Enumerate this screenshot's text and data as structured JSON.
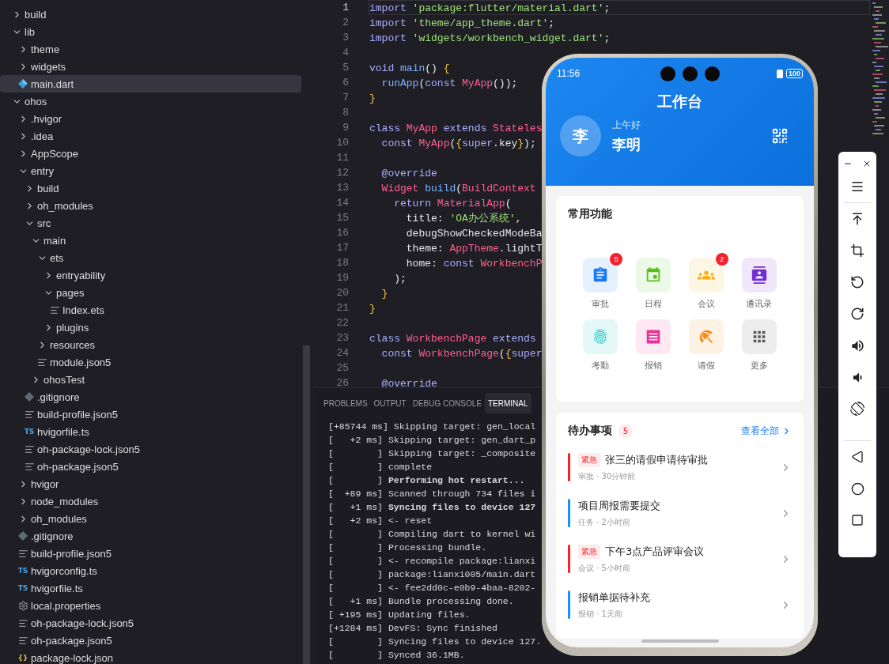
{
  "explorer": {
    "tree": [
      {
        "name": "build",
        "kind": "folder",
        "expanded": false,
        "selected": false
      },
      {
        "name": "lib",
        "kind": "folder",
        "expanded": true,
        "selected": false,
        "children": [
          {
            "name": "theme",
            "kind": "folder",
            "expanded": false,
            "selected": false
          },
          {
            "name": "widgets",
            "kind": "folder",
            "expanded": false,
            "selected": false
          },
          {
            "name": "main.dart",
            "kind": "dart",
            "selected": true
          }
        ]
      },
      {
        "name": "ohos",
        "kind": "folder",
        "expanded": true,
        "selected": false,
        "children": [
          {
            "name": ".hvigor",
            "kind": "folder",
            "expanded": false,
            "selected": false
          },
          {
            "name": ".idea",
            "kind": "folder",
            "expanded": false,
            "selected": false
          },
          {
            "name": "AppScope",
            "kind": "folder",
            "expanded": false,
            "selected": false
          },
          {
            "name": "entry",
            "kind": "folder",
            "expanded": true,
            "selected": false,
            "children": [
              {
                "name": "build",
                "kind": "folder",
                "expanded": false,
                "selected": false
              },
              {
                "name": "oh_modules",
                "kind": "folder",
                "expanded": false,
                "selected": false
              },
              {
                "name": "src",
                "kind": "folder",
                "expanded": true,
                "selected": false,
                "children": [
                  {
                    "name": "main",
                    "kind": "folder",
                    "expanded": true,
                    "selected": false,
                    "children": [
                      {
                        "name": "ets",
                        "kind": "folder",
                        "expanded": true,
                        "selected": false,
                        "children": [
                          {
                            "name": "entryability",
                            "kind": "folder",
                            "expanded": false,
                            "selected": false
                          },
                          {
                            "name": "pages",
                            "kind": "folder",
                            "expanded": true,
                            "selected": false,
                            "children": [
                              {
                                "name": "Index.ets",
                                "kind": "text",
                                "selected": false
                              }
                            ]
                          },
                          {
                            "name": "plugins",
                            "kind": "folder",
                            "expanded": false,
                            "selected": false
                          }
                        ]
                      },
                      {
                        "name": "resources",
                        "kind": "folder",
                        "expanded": false,
                        "selected": false
                      },
                      {
                        "name": "module.json5",
                        "kind": "text",
                        "selected": false
                      }
                    ]
                  },
                  {
                    "name": "ohosTest",
                    "kind": "folder",
                    "expanded": false,
                    "selected": false
                  }
                ]
              },
              {
                "name": ".gitignore",
                "kind": "git",
                "selected": false
              },
              {
                "name": "build-profile.json5",
                "kind": "text",
                "selected": false
              },
              {
                "name": "hvigorfile.ts",
                "kind": "ts",
                "icon_text": "TS",
                "selected": false
              },
              {
                "name": "oh-package-lock.json5",
                "kind": "text",
                "selected": false
              },
              {
                "name": "oh-package.json5",
                "kind": "text",
                "selected": false
              }
            ]
          },
          {
            "name": "hvigor",
            "kind": "folder",
            "expanded": false,
            "selected": false
          },
          {
            "name": "node_modules",
            "kind": "folder",
            "expanded": false,
            "selected": false
          },
          {
            "name": "oh_modules",
            "kind": "folder",
            "expanded": false,
            "selected": false
          },
          {
            "name": ".gitignore",
            "kind": "git",
            "selected": false
          },
          {
            "name": "build-profile.json5",
            "kind": "text",
            "selected": false
          },
          {
            "name": "hvigorconfig.ts",
            "kind": "ts",
            "icon_text": "TS",
            "selected": false
          },
          {
            "name": "hvigorfile.ts",
            "kind": "ts",
            "icon_text": "TS",
            "selected": false
          },
          {
            "name": "local.properties",
            "kind": "gear",
            "selected": false
          },
          {
            "name": "oh-package-lock.json5",
            "kind": "text",
            "selected": false
          },
          {
            "name": "oh-package.json5",
            "kind": "text",
            "selected": false
          },
          {
            "name": "package-lock.json",
            "kind": "json",
            "icon_text": "{}",
            "selected": false
          }
        ]
      }
    ]
  },
  "editor": {
    "lines": [
      {
        "number": "1",
        "current": true,
        "tokens": [
          {
            "text": "import ",
            "kind": "kw"
          },
          {
            "text": "'package:flutter/material.dart'",
            "kind": "str"
          },
          {
            "text": ";",
            "kind": "punct"
          }
        ]
      },
      {
        "number": "2",
        "current": false,
        "tokens": [
          {
            "text": "import ",
            "kind": "kw"
          },
          {
            "text": "'theme/app_theme.dart'",
            "kind": "str"
          },
          {
            "text": ";",
            "kind": "punct"
          }
        ]
      },
      {
        "number": "3",
        "current": false,
        "tokens": [
          {
            "text": "import ",
            "kind": "kw"
          },
          {
            "text": "'widgets/workbench_widget.dart'",
            "kind": "str"
          },
          {
            "text": ";",
            "kind": "punct"
          }
        ]
      },
      {
        "number": "4",
        "current": false
      },
      {
        "number": "5",
        "current": false,
        "tokens": [
          {
            "text": "void ",
            "kind": "kw"
          },
          {
            "text": "main",
            "kind": "fn"
          },
          {
            "text": "() ",
            "kind": "punct"
          },
          {
            "text": "{",
            "kind": "brace"
          }
        ]
      },
      {
        "number": "6",
        "current": false,
        "tokens": [
          {
            "text": "  runApp",
            "kind": "fn"
          },
          {
            "text": "(",
            "kind": "punct"
          },
          {
            "text": "const ",
            "kind": "kw"
          },
          {
            "text": "MyApp",
            "kind": "type"
          },
          {
            "text": "());",
            "kind": "punct"
          }
        ]
      },
      {
        "number": "7",
        "current": false,
        "tokens": [
          {
            "text": "}",
            "kind": "brace"
          }
        ]
      },
      {
        "number": "8",
        "current": false
      },
      {
        "number": "9",
        "current": false,
        "tokens": [
          {
            "text": "class ",
            "kind": "kw"
          },
          {
            "text": "MyApp ",
            "kind": "type"
          },
          {
            "text": "extends ",
            "kind": "kw"
          },
          {
            "text": "Stateles",
            "kind": "type"
          }
        ]
      },
      {
        "number": "10",
        "current": false,
        "tokens": [
          {
            "text": "  const ",
            "kind": "kw"
          },
          {
            "text": "MyApp",
            "kind": "type"
          },
          {
            "text": "(",
            "kind": "punct"
          },
          {
            "text": "{",
            "kind": "brace"
          },
          {
            "text": "super",
            "kind": "kw"
          },
          {
            "text": ".key",
            "kind": "plain"
          },
          {
            "text": "}",
            "kind": "brace"
          },
          {
            "text": ");",
            "kind": "punct"
          }
        ]
      },
      {
        "number": "11",
        "current": false
      },
      {
        "number": "12",
        "current": false,
        "tokens": [
          {
            "text": "  @override",
            "kind": "kw"
          }
        ]
      },
      {
        "number": "13",
        "current": false,
        "tokens": [
          {
            "text": "  Widget ",
            "kind": "type"
          },
          {
            "text": "build",
            "kind": "fn"
          },
          {
            "text": "(",
            "kind": "punct"
          },
          {
            "text": "BuildContext",
            "kind": "type"
          }
        ]
      },
      {
        "number": "14",
        "current": false,
        "tokens": [
          {
            "text": "    return ",
            "kind": "kw"
          },
          {
            "text": "MaterialApp",
            "kind": "type"
          },
          {
            "text": "(",
            "kind": "punct"
          }
        ]
      },
      {
        "number": "15",
        "current": false,
        "tokens": [
          {
            "text": "      title: ",
            "kind": "plain"
          },
          {
            "text": "'OA办公系统'",
            "kind": "str"
          },
          {
            "text": ",",
            "kind": "punct"
          }
        ]
      },
      {
        "number": "16",
        "current": false,
        "tokens": [
          {
            "text": "      debugShowCheckedModeBa",
            "kind": "plain"
          }
        ]
      },
      {
        "number": "17",
        "current": false,
        "tokens": [
          {
            "text": "      theme: ",
            "kind": "plain"
          },
          {
            "text": "AppTheme",
            "kind": "type"
          },
          {
            "text": ".lightT",
            "kind": "plain"
          }
        ]
      },
      {
        "number": "18",
        "current": false,
        "tokens": [
          {
            "text": "      home: ",
            "kind": "plain"
          },
          {
            "text": "const ",
            "kind": "kw"
          },
          {
            "text": "WorkbenchP",
            "kind": "type"
          }
        ]
      },
      {
        "number": "19",
        "current": false,
        "tokens": [
          {
            "text": "    );",
            "kind": "punct"
          }
        ]
      },
      {
        "number": "20",
        "current": false,
        "tokens": [
          {
            "text": "  }",
            "kind": "brace"
          }
        ]
      },
      {
        "number": "21",
        "current": false,
        "tokens": [
          {
            "text": "}",
            "kind": "brace"
          }
        ]
      },
      {
        "number": "22",
        "current": false
      },
      {
        "number": "23",
        "current": false,
        "tokens": [
          {
            "text": "class ",
            "kind": "kw"
          },
          {
            "text": "WorkbenchPage ",
            "kind": "type"
          },
          {
            "text": "extends",
            "kind": "kw"
          }
        ]
      },
      {
        "number": "24",
        "current": false,
        "tokens": [
          {
            "text": "  const ",
            "kind": "kw"
          },
          {
            "text": "WorkbenchPage",
            "kind": "type"
          },
          {
            "text": "(",
            "kind": "punct"
          },
          {
            "text": "{",
            "kind": "brace"
          },
          {
            "text": "super",
            "kind": "kw"
          }
        ]
      },
      {
        "number": "25",
        "current": false
      },
      {
        "number": "26",
        "current": false,
        "tokens": [
          {
            "text": "  @override",
            "kind": "kw"
          }
        ]
      }
    ]
  },
  "panel": {
    "tabs": [
      {
        "label": "PROBLEMS",
        "selected": false
      },
      {
        "label": "OUTPUT",
        "selected": false
      },
      {
        "label": "DEBUG CONSOLE",
        "selected": false
      },
      {
        "label": "TERMINAL",
        "selected": true
      }
    ],
    "terminal_lines": [
      "[+85744 ms] Skipping target: gen_local",
      "[   +2 ms] Skipping target: gen_dart_p",
      "[        ] Skipping target: _composite",
      "[        ] complete",
      "[        ] **Performing hot restart...**",
      "[  +89 ms] Scanned through 734 files i",
      "[   +1 ms] **Syncing files to device 127**",
      "[   +2 ms] <- reset",
      "[        ] Compiling dart to kernel wi",
      "[        ] Processing bundle.",
      "[        ] <- recompile package:lianxi",
      "[        ] package:lianxi005/main.dart",
      "[        ] <- fee2dd0c-e0b9-4baa-8202-",
      "[   +1 ms] Bundle processing done.",
      "[ +195 ms] Updating files.",
      "[+1284 ms] DevFS: Sync finished",
      "[        ] Syncing files to device 127.",
      "[        ] Synced 36.1MB."
    ]
  },
  "phone": {
    "status_bar": {
      "time": "11:56",
      "battery": "100"
    },
    "header": {
      "title": "工作台",
      "avatar": "李",
      "greeting": "上午好",
      "name": "李明"
    },
    "shortcuts": {
      "title": "常用功能",
      "items": [
        {
          "label": "审批",
          "color": "#1677ff",
          "badge": "5"
        },
        {
          "label": "日程",
          "color": "#52c41a"
        },
        {
          "label": "会议",
          "color": "#faad14",
          "badge": "2"
        },
        {
          "label": "通讯录",
          "color": "#722ed1"
        },
        {
          "label": "考勤",
          "color": "#13c2c2"
        },
        {
          "label": "报销",
          "color": "#eb2f96"
        },
        {
          "label": "请假",
          "color": "#fa8c16"
        },
        {
          "label": "更多",
          "color": "#595959"
        }
      ]
    },
    "todos": {
      "title": "待办事项",
      "count": "5",
      "link": "查看全部",
      "items": [
        {
          "tag": "紧急",
          "title": "张三的请假申请待审批",
          "meta": "审批 · 30分钟前",
          "color": "#f5222d"
        },
        {
          "title": "项目周报需要提交",
          "meta": "任务 · 2小时前",
          "color": "#1890ff"
        },
        {
          "tag": "紧急",
          "title": "下午3点产品评审会议",
          "meta": "会议 · 5小时前",
          "color": "#f5222d"
        },
        {
          "title": "报销单据待补充",
          "meta": "报销 · 1天前",
          "color": "#1890ff"
        }
      ]
    }
  }
}
